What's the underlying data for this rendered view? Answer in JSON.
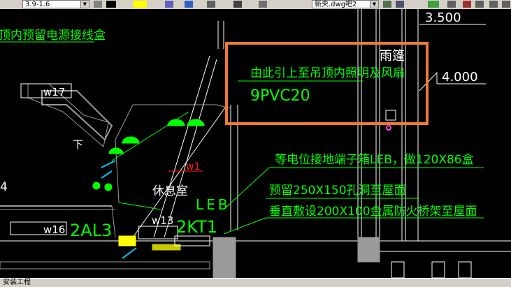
{
  "toolbar": {
    "linetype_scale": "3.9-1.6",
    "file_tab": "新央.dwg吧2",
    "colors": {
      "yellow_swatch": "#ffff00",
      "bg": "#d4d0c8"
    }
  },
  "drawing": {
    "labels": {
      "top_left_note": "顶内预留电源接线盒",
      "room_w17": "w17",
      "down_mark": "下",
      "num_4_left": "4",
      "room_w16": "w16",
      "panel_2al3": "2AL3",
      "room_w13": "w13",
      "panel_2kt1": "2KT1",
      "leb": "LEB",
      "rest_room": "休息室",
      "w1": "w1",
      "dim_3500": "3.500",
      "dim_4000": "4.000",
      "rain_shelter": "雨篷",
      "callout_line1": "由此引上至吊顶内照明及风扇",
      "callout_line2": "9PVC20",
      "leb_note": "等电位接地端子箱LEB，做120X86盒",
      "hole_note": "预留250X150孔洞至屋面",
      "tray_note": "垂直敷设200X100金属防火桥架至屋面"
    },
    "colors": {
      "background": "#000000",
      "green_text": "#00ff00",
      "white_lines": "#ffffff",
      "grey_walls": "#9a9a9a",
      "yellow": "#ffff00",
      "cyan": "#00c8ff",
      "red": "#ff2020",
      "orange_highlight": "#f07a30",
      "magenta": "#ff40ff"
    }
  },
  "statusbar": {
    "text": "安装工程"
  }
}
